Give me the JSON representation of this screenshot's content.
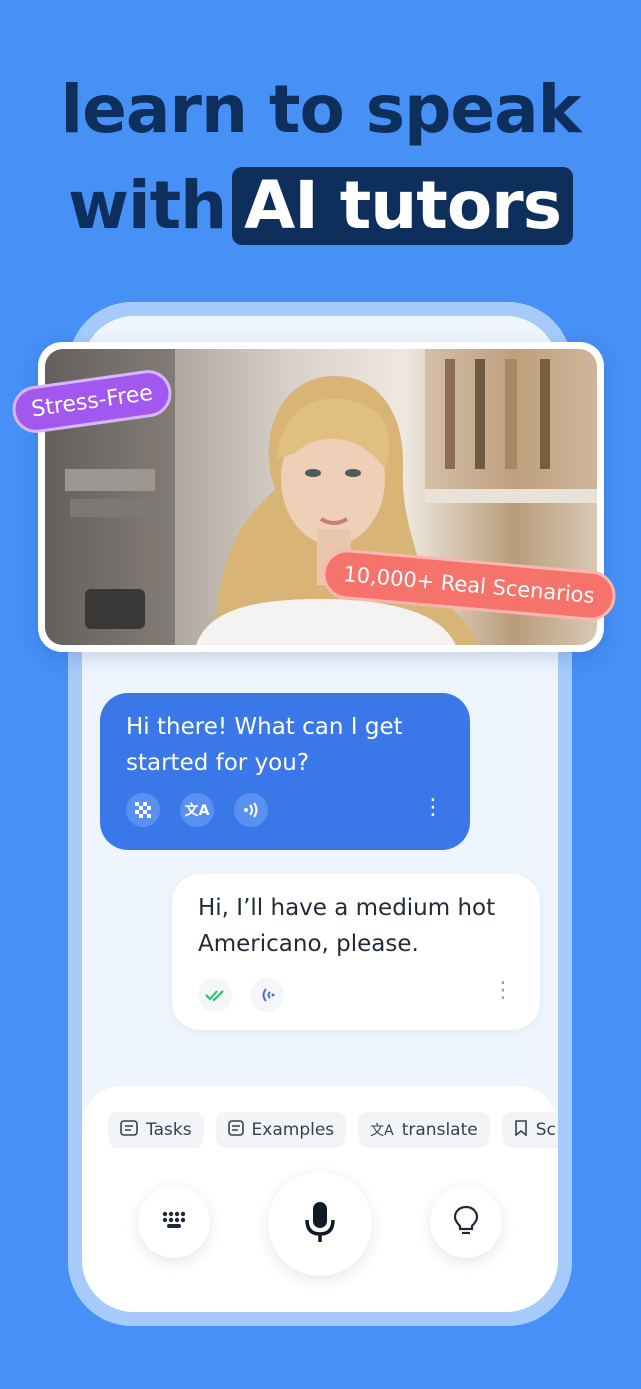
{
  "headline": {
    "line1": "learn to speak",
    "line2_prefix": "with",
    "line2_highlight": "AI tutors"
  },
  "tags": {
    "stress_free": "Stress-Free",
    "scenarios": "10,000+ Real Scenarios"
  },
  "chat": {
    "ai_message": "Hi there! What can I get started for you?",
    "ai_tools": [
      "blur-icon",
      "translate-icon",
      "audio-icon"
    ],
    "user_message": "Hi, I’ll have a medium hot Americano, please.",
    "user_tools": [
      "double-check-icon",
      "audio-wave-icon"
    ]
  },
  "chips": [
    {
      "icon": "tasks-icon",
      "label": "Tasks"
    },
    {
      "icon": "examples-icon",
      "label": "Examples"
    },
    {
      "icon": "translate-icon",
      "label": "translate"
    },
    {
      "icon": "bookmark-icon",
      "label": "Sc"
    }
  ],
  "controls": [
    "keyboard-icon",
    "microphone-icon",
    "lightbulb-icon"
  ],
  "colors": {
    "background": "#4690f6",
    "headline": "#0e2f5c",
    "ai_bubble": "#3a78ea",
    "stress_tag": "#a258ef",
    "scenario_tag": "#f5736a"
  }
}
